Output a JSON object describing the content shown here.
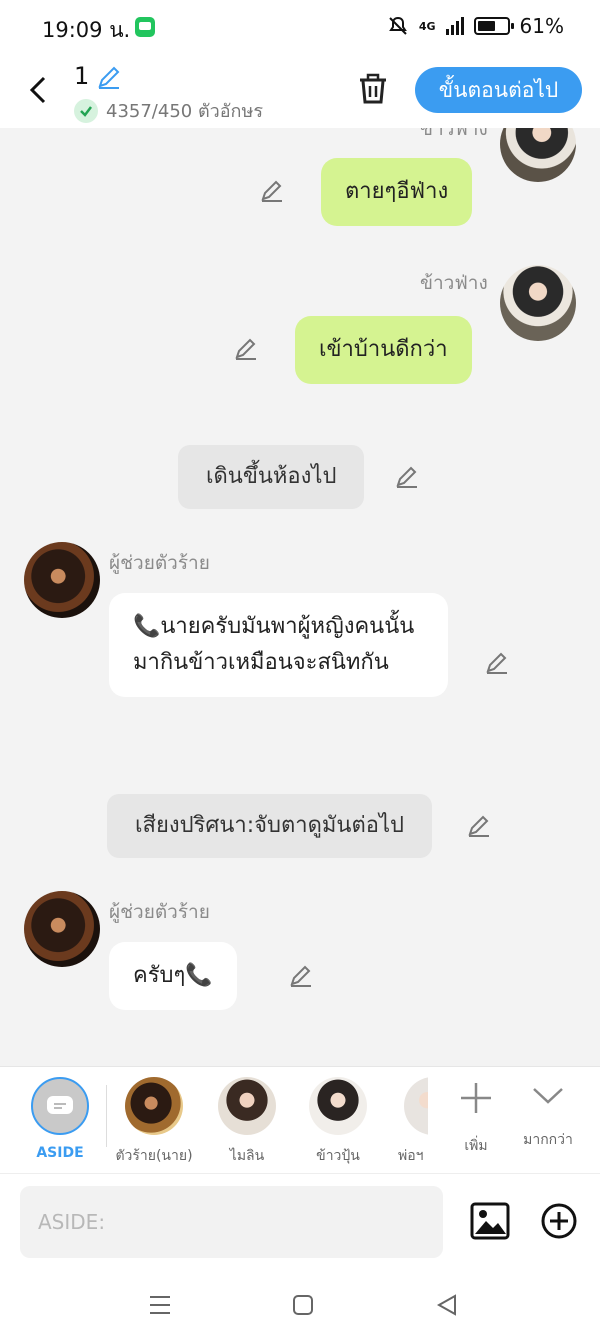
{
  "status": {
    "time": "19:09 น.",
    "network": "4G",
    "battery": "61%",
    "battery_level": 0.61
  },
  "header": {
    "title": "1",
    "char_count": "4357/450 ตัวอักษร",
    "next_label": "ขั้นตอนต่อไป"
  },
  "messages": [
    {
      "kind": "right",
      "name": "ข้าวฟ่าง",
      "text": "ตายๆอีฟ่าง"
    },
    {
      "kind": "right",
      "name": "ข้าวฟ่าง",
      "text": "เข้าบ้านดีกว่า"
    },
    {
      "kind": "narration",
      "text": "เดินขึ้นห้องไป"
    },
    {
      "kind": "left",
      "name": "ผู้ช่วยตัวร้าย",
      "text": "📞นายครับมันพาผู้หญิงคนนั้นมากินข้าวเหมือนจะสนิทกัน"
    },
    {
      "kind": "narration",
      "text": "เสียงปริศนา:จับตาดูมันต่อไป"
    },
    {
      "kind": "left",
      "name": "ผู้ช่วยตัวร้าย",
      "text": "ครับๆ📞"
    }
  ],
  "characters": {
    "aside": "ASIDE",
    "c1": "ตัวร้าย(นาย)",
    "c2": "ไมลิน",
    "c3": "ข้าวปุ้น",
    "c4": "พ่อฯ",
    "add": "เพิ่ม",
    "more": "มากกว่า"
  },
  "input": {
    "placeholder": "ASIDE:"
  },
  "colors": {
    "accent": "#3b9cf1",
    "green_bubble": "#d5f391"
  }
}
